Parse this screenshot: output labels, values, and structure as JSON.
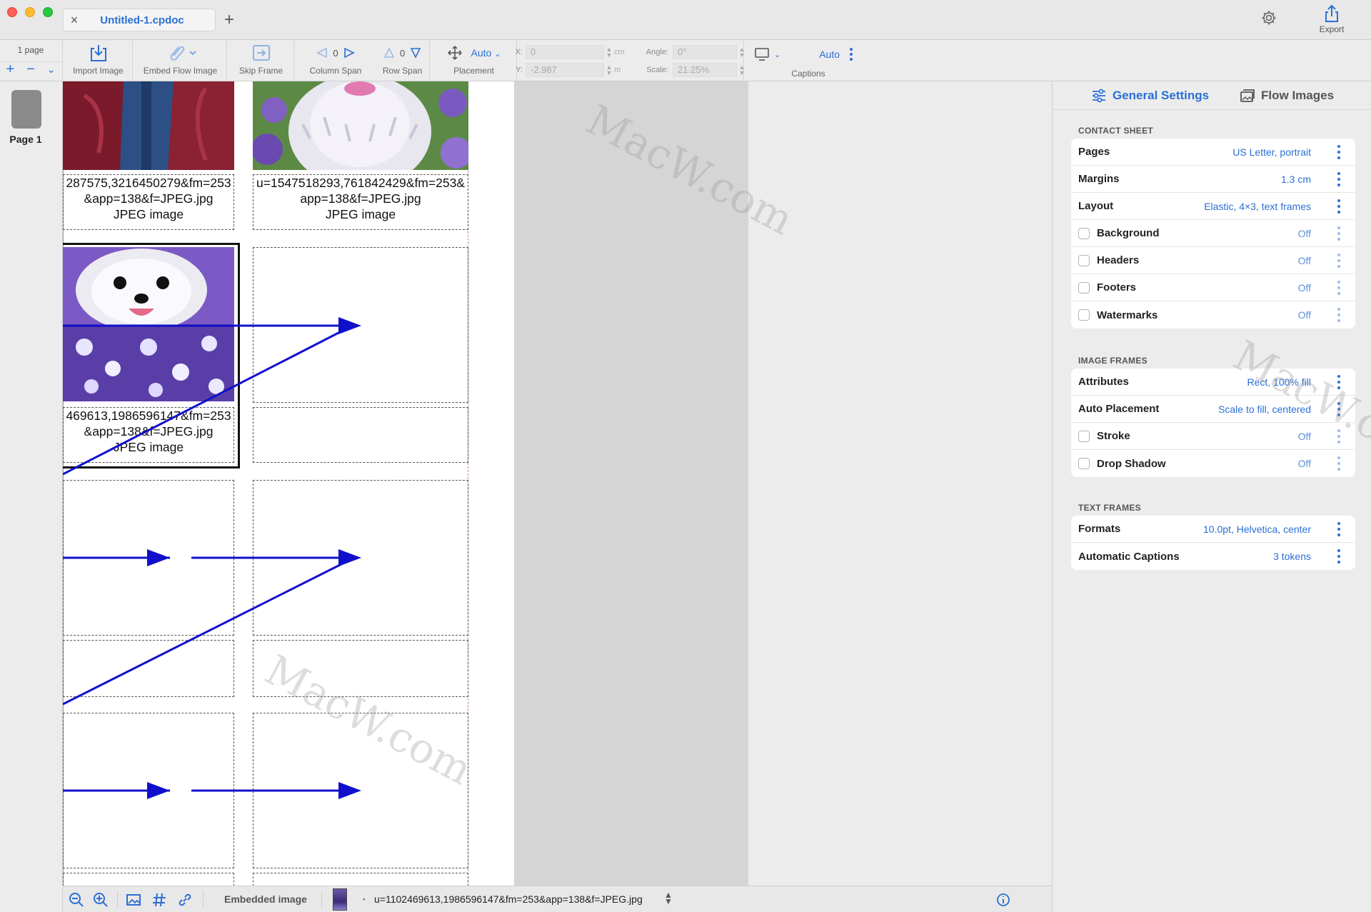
{
  "window": {
    "doc_tab": "Untitled-1.cpdoc",
    "export_label": "Export"
  },
  "toolbar": {
    "page_count": "1 page",
    "import_image": "Import Image",
    "embed_flow_image": "Embed Flow Image",
    "skip_frame": "Skip Frame",
    "column_span_value": "0",
    "column_span": "Column Span",
    "row_span_value": "0",
    "row_span": "Row Span",
    "placement_value": "Auto",
    "placement": "Placement",
    "x_label": "X:",
    "x_value": "0",
    "y_label": "Y:",
    "y_value": "-2.987",
    "x_unit": "cm",
    "y_unit": "m",
    "angle_label": "Angle:",
    "angle_value": "0°",
    "scale_label": "Scale:",
    "scale_value": "21.25%",
    "captions_value": "Auto",
    "captions": "Captions"
  },
  "pages_sidebar": {
    "page_label": "Page 1"
  },
  "canvas": {
    "captions": [
      {
        "line1": "287575,3216450279&fm=253",
        "line2": "&app=138&f=JPEG.jpg",
        "line3": "JPEG image"
      },
      {
        "line1": "u=1547518293,761842429&fm=253&",
        "line2": "app=138&f=JPEG.jpg",
        "line3": "JPEG image"
      },
      {
        "line1": "469613,1986596147&fm=253",
        "line2": "&app=138&f=JPEG.jpg",
        "line3": "JPEG image"
      }
    ]
  },
  "statusbar": {
    "embedded_label": "Embedded image",
    "filename": "u=1102469613,1986596147&fm=253&app=138&f=JPEG.jpg"
  },
  "inspector": {
    "tabs": {
      "general": "General Settings",
      "flow": "Flow Images"
    },
    "contact_sheet": {
      "title": "CONTACT SHEET",
      "rows": [
        {
          "name": "Pages",
          "value": "US Letter, portrait"
        },
        {
          "name": "Margins",
          "value": "1.3 cm"
        },
        {
          "name": "Layout",
          "value": "Elastic, 4×3, text frames"
        },
        {
          "name": "Background",
          "value": "Off"
        },
        {
          "name": "Headers",
          "value": "Off"
        },
        {
          "name": "Footers",
          "value": "Off"
        },
        {
          "name": "Watermarks",
          "value": "Off"
        }
      ]
    },
    "image_frames": {
      "title": "IMAGE FRAMES",
      "rows": [
        {
          "name": "Attributes",
          "value": "Rect, 100% fill"
        },
        {
          "name": "Auto Placement",
          "value": "Scale to fill, centered"
        },
        {
          "name": "Stroke",
          "value": "Off"
        },
        {
          "name": "Drop Shadow",
          "value": "Off"
        }
      ]
    },
    "text_frames": {
      "title": "TEXT FRAMES",
      "rows": [
        {
          "name": "Formats",
          "value": "10.0pt, Helvetica, center"
        },
        {
          "name": "Automatic Captions",
          "value": "3 tokens"
        }
      ]
    }
  },
  "watermark_text": "MacW.com",
  "colors": {
    "accent": "#2a6fd6",
    "arrow": "#1010cc"
  }
}
